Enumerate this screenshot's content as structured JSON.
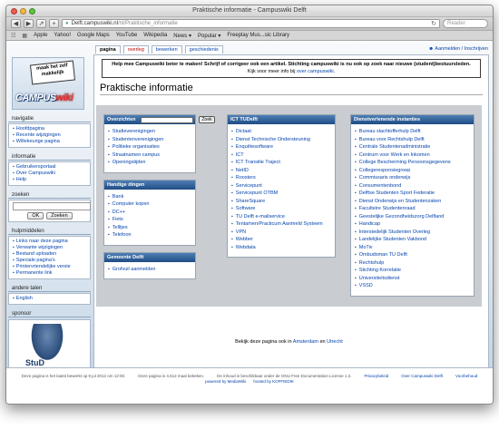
{
  "window": {
    "title": "Praktische informatie - Campuswiki Delft"
  },
  "toolbar": {
    "url_host": "Delft.campuswiki.nl",
    "url_path": "/nl/Praktische_informatie",
    "search_placeholder": "Reader"
  },
  "bookmarks": [
    "Apple",
    "Yahoo!",
    "Google Maps",
    "YouTube",
    "Wikipedia",
    "News",
    "Popular",
    "Freeplay Mus...sic Library"
  ],
  "page_tabs": [
    "pagina",
    "overleg",
    "bewerken",
    "geschiedenis"
  ],
  "personal": "Aanmelden / Inschrijven",
  "logo": {
    "sign": "maak het zelf makkelijk",
    "wordmark": "CAMPUS",
    "wordmark2": "wiki",
    "delft": "Delft"
  },
  "sidebar": {
    "navigatie": {
      "title": "navigatie",
      "items": [
        "Hoofdpagina",
        "Recente wijzigingen",
        "Willekeurige pagina"
      ]
    },
    "informatie": {
      "title": "informatie",
      "items": [
        "Gebruikersportaal",
        "Over Campuswiki",
        "Help"
      ]
    },
    "zoeken": {
      "title": "zoeken",
      "ok": "OK",
      "zoeken": "Zoeken"
    },
    "hulpmiddelen": {
      "title": "hulpmiddelen",
      "items": [
        "Links naar deze pagina",
        "Verwante wijzigingen",
        "Bestand uploaden",
        "Speciale pagina's",
        "Printervriendelijke versie",
        "Permanente link"
      ]
    },
    "andere_talen": {
      "title": "andere talen",
      "items": [
        "English"
      ]
    },
    "sponsor": {
      "title": "sponsor",
      "text": "StuD"
    }
  },
  "sitenotice": {
    "main": "Help mee Campuswiki beter te maken! Schrijf of corrigeer ook een artikel. Stichting campuswiki is nu ook op zoek naar nieuwe (student)bestuursleden.",
    "sub_prefix": "Kijk voor meer info bij",
    "sub_link": "over campuswiki"
  },
  "page_title": "Praktische informatie",
  "portal": {
    "overzichten": {
      "title": "Overzichten",
      "button": "Zoek",
      "items": [
        "Studieverenigingen",
        "Studentenverenigingen",
        "Politieke organisaties",
        "Straatnamen campus",
        "Openingstijden"
      ]
    },
    "handige_dingen": {
      "title": "Handige dingen",
      "items": [
        "Bank",
        "Computer kopen",
        "DC++",
        "Fiets",
        "Telltjes",
        "Telefoon"
      ]
    },
    "gemeente": {
      "title": "Gemeente Delft",
      "items": [
        "Grofvuil aanmelden"
      ]
    },
    "ict": {
      "title": "ICT TUDelft",
      "items": [
        "Dictaat",
        "Dienst Technische Ondersteuning",
        "Enquêtesoftware",
        "ICT",
        "ICT Transitie Traject",
        "NetID",
        "Roosters",
        "Servicepunt",
        "Servicepunt OTBM",
        "ShareSquare",
        "Software",
        "TU Delft e-mailservice",
        "Tentamen/Practicum Aanmeld Systeem",
        "VPN",
        "Webber",
        "Webdata"
      ]
    },
    "dienst": {
      "title": "Dienstverlenende instanties",
      "items": [
        "Bureau slachtofferhulp Delft",
        "Bureau voor Rechtshulp Delft",
        "Centrale Studentenadministratie",
        "Centrum voor Werk en Inkomen",
        "College Bescherming Persoonsgegevens",
        "Collegeresponsiegroep",
        "Commissaris onderwijs",
        "Consumentenbond",
        "Delftse Studenten Sport Federatie",
        "Dienst Onderwijs en Studentenzaken",
        "Faculteire Studentenraad",
        "Geestelijke Gezondheidszorg Delfland",
        "Handicap",
        "Interstedelijk Studenten Overleg",
        "Landelijke Studenten Vakbond",
        "MoTiv",
        "Ombudsman TU Delft",
        "Rechtshulp",
        "Stichting Korrelatie",
        "Universiteitsdienst",
        "VSSD"
      ]
    },
    "note_prefix": "Bekijk deze pagina ook in",
    "note_link1": "Amsterdam",
    "note_mid": "en",
    "note_link2": "Utrecht"
  },
  "footer": {
    "row1": [
      "Deze pagina is het laatst bewerkt op 9 jul 2012 om 12:00.",
      "Deze pagina is 4.512 maal bekeken.",
      "De inhoud is beschikbaar onder de GNU Free Documentation License 1.2.",
      "Privacybeleid",
      "Over Campuswiki Delft",
      "Voorbehoud"
    ],
    "row2": [
      "powered by MediaWiki",
      "hosted by KOFFIEDIK"
    ]
  }
}
